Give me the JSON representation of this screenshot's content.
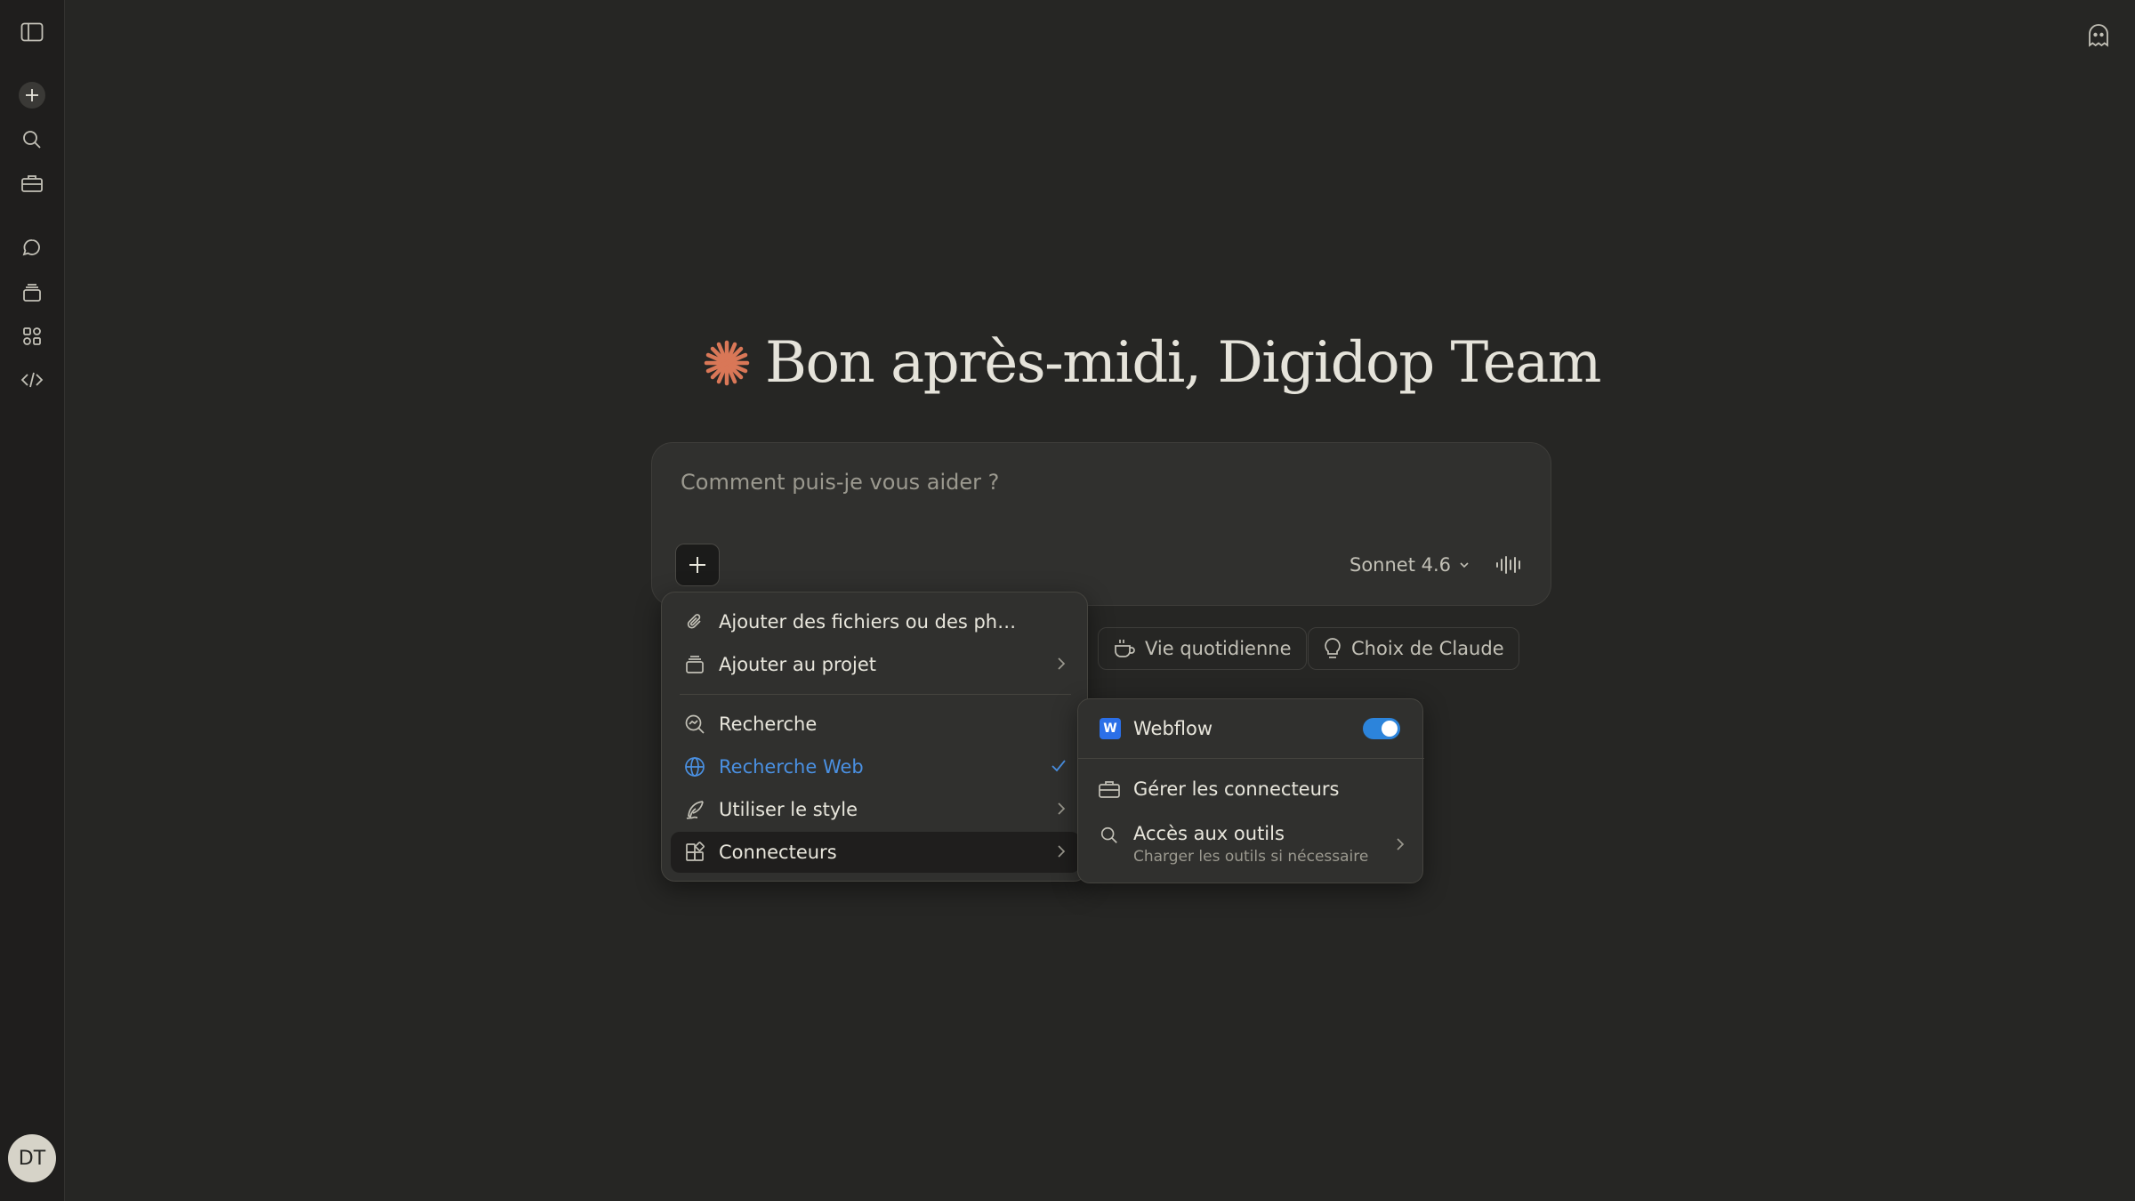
{
  "greeting": {
    "text": "Bon après-midi, Digidop Team"
  },
  "composer": {
    "placeholder": "Comment puis-je vous aider ?",
    "model_label": "Sonnet 4.6"
  },
  "chips": [
    {
      "label": "Vie quotidienne",
      "icon": "coffee-cup-icon"
    },
    {
      "label": "Choix de Claude",
      "icon": "lightbulb-icon"
    }
  ],
  "menu": {
    "items": [
      {
        "label": "Ajouter des fichiers ou des ph…",
        "icon": "paperclip-icon"
      },
      {
        "label": "Ajouter au projet",
        "icon": "project-box-icon"
      },
      {
        "label": "Recherche",
        "icon": "research-icon"
      },
      {
        "label": "Recherche Web",
        "icon": "globe-icon",
        "checked": true,
        "color": "#4a90e2"
      },
      {
        "label": "Utiliser le style",
        "icon": "quill-icon"
      },
      {
        "label": "Connecteurs",
        "icon": "connectors-icon"
      }
    ]
  },
  "submenu": {
    "webflow": {
      "label": "Webflow",
      "logo": "W",
      "enabled": true
    },
    "manage": {
      "label": "Gérer les connecteurs"
    },
    "tools": {
      "label": "Accès aux outils",
      "desc": "Charger les outils si nécessaire"
    }
  },
  "user": {
    "initials": "DT"
  },
  "colors": {
    "accent": "#d97757",
    "toggle": "#2c84db",
    "link": "#4a90e2",
    "background": "#262624"
  }
}
